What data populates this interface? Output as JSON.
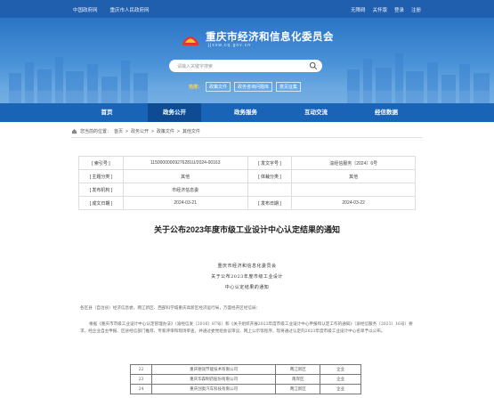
{
  "topbar": {
    "left_links": [
      "中国政府网",
      "重庆市人民政府网"
    ],
    "right_links": [
      "无障碍",
      "关怀版",
      "登录",
      "注册"
    ]
  },
  "header": {
    "title": "重庆市经济和信息化委员会",
    "subtitle": "jjxxw.cq.gov.cn",
    "search_placeholder": "请输入关键字搜索",
    "hot_label": "热搜：",
    "hot_tags": [
      "政策文件",
      "政务咨询问题库",
      "意见征集"
    ]
  },
  "nav": [
    {
      "label": "首页",
      "active": false
    },
    {
      "label": "政务公开",
      "active": true
    },
    {
      "label": "政务服务",
      "active": false
    },
    {
      "label": "互动交流",
      "active": false
    },
    {
      "label": "经信数据",
      "active": false
    }
  ],
  "breadcrumb": [
    "您当前的位置：",
    "首页",
    ">",
    "政务公开",
    ">",
    "政策文件",
    ">",
    "其他文件"
  ],
  "meta": {
    "rows": [
      [
        "[ 索引号 ]",
        "11500000009276281U/2024-00163",
        "[ 发文字号 ]",
        "渝经信服务〔2024〕6号"
      ],
      [
        "[ 主题分类 ]",
        "其他",
        "[ 体裁分类 ]",
        "其他"
      ],
      [
        "[ 发布机构 ]",
        "市经济信息委",
        "",
        ""
      ],
      [
        "[ 成文日期 ]",
        "2024-03-21",
        "[ 发布日期 ]",
        "2024-03-22"
      ]
    ]
  },
  "article": {
    "title": "关于公布2023年度市级工业设计中心认定结果的通知"
  },
  "document": {
    "heading": "重庆市经济和信息化委员会",
    "heading2": "关于公布2023年度市级工业设计",
    "heading3": "中心认定结果的通知",
    "greeting": "各区县（自治县）经济信息委，两江新区、西部科学城重庆高新区经济运行局，万盛经开区经信局：",
    "para1": "根据《重庆市市级工业设计中心认定管理办法》（渝经信发〔2016〕87号）和《关于组织开展2023年度市级工业设计中心申报和认定工作的通知》（渝经信服务〔2023〕16号）要求，经企业自主申报、区县经信部门推荐、专家评审和现场审查，并通过委党组会议审议、网上公示等程序，现将通过认定的2023年度市级工业设计中心名单予以公布。",
    "table": [
      [
        "22",
        "重庆德润节能技术有限公司",
        "两江新区",
        "企业"
      ],
      [
        "23",
        "重庆华森制药股份有限公司",
        "南岸区",
        "企业"
      ],
      [
        "24",
        "重庆创奥汽车科技有限公司",
        "两江新区",
        "企业"
      ]
    ]
  },
  "colors": {
    "topbar": "#1f5fae",
    "nav": "#1a64b8",
    "nav_active": "#0e4b92",
    "accent_gold": "#ffd24a"
  }
}
